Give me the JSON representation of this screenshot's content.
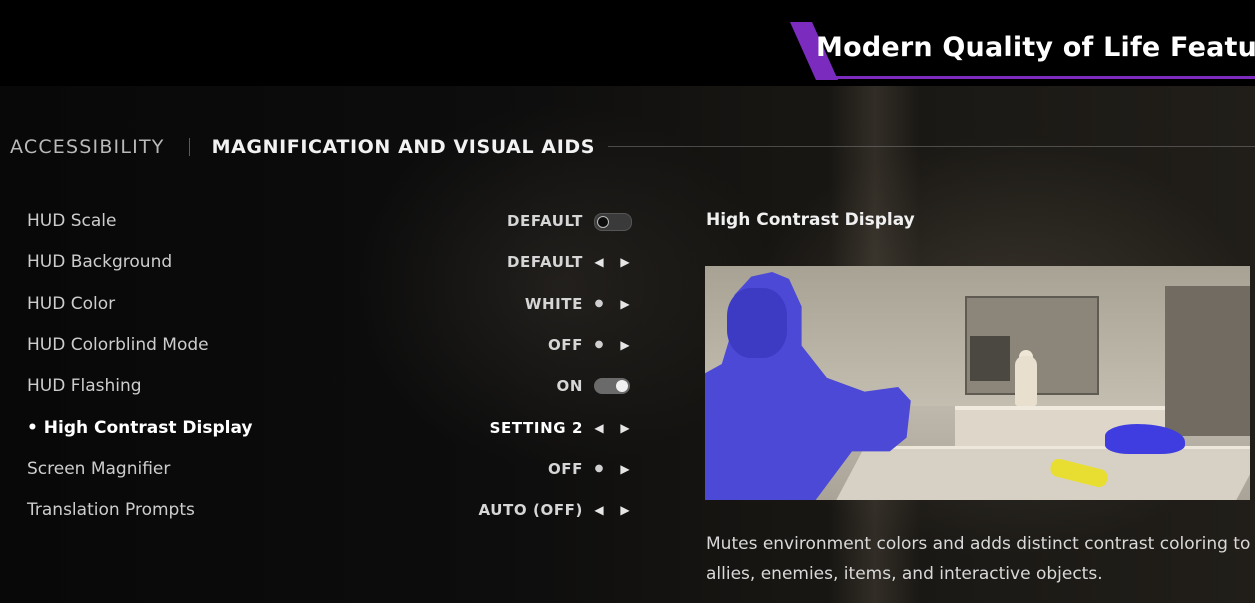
{
  "overlay": {
    "banner_title": "Modern Quality of Life Features",
    "accent_color": "#7b2cbf"
  },
  "header": {
    "category": "ACCESSIBILITY",
    "page": "MAGNIFICATION AND VISUAL AIDS"
  },
  "settings": [
    {
      "label": "HUD Scale",
      "value": "DEFAULT",
      "control": "toggle",
      "toggle_on": false,
      "selected": false
    },
    {
      "label": "HUD Background",
      "value": "DEFAULT",
      "control": "arrows",
      "selected": false
    },
    {
      "label": "HUD Color",
      "value": "WHITE",
      "control": "dot-arrow",
      "selected": false
    },
    {
      "label": "HUD Colorblind Mode",
      "value": "OFF",
      "control": "dot-arrow",
      "selected": false
    },
    {
      "label": "HUD Flashing",
      "value": "ON",
      "control": "toggle",
      "toggle_on": true,
      "selected": false
    },
    {
      "label": "• High Contrast Display",
      "value": "SETTING 2",
      "control": "arrows",
      "selected": true
    },
    {
      "label": "Screen Magnifier",
      "value": "OFF",
      "control": "dot-arrow",
      "selected": false
    },
    {
      "label": "Translation Prompts",
      "value": "AUTO (OFF)",
      "control": "arrows",
      "selected": false
    }
  ],
  "detail": {
    "title": "High Contrast Display",
    "description": "Mutes environment colors and adds distinct contrast coloring to allies, enemies, items, and interactive objects.",
    "preview_colors": {
      "ally": "#4b49d6",
      "enemy": "#3f3de0",
      "item": "#e8de32"
    }
  },
  "icons": {
    "arrow_left": "◀",
    "arrow_right": "▶",
    "dot": "●"
  }
}
